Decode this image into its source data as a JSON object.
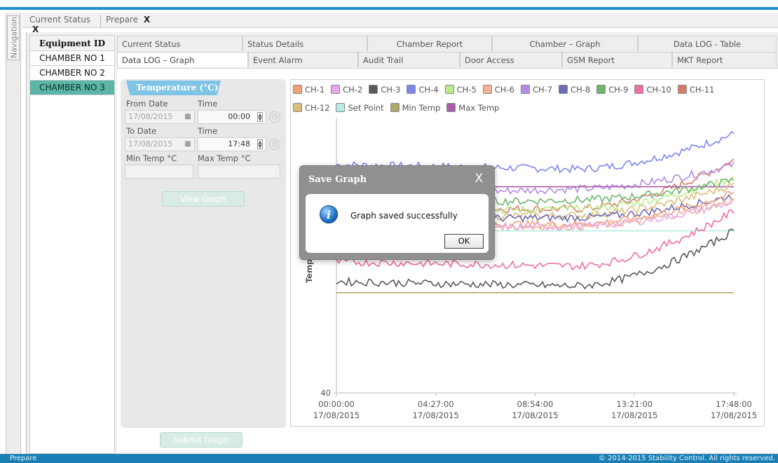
{
  "navigation": {
    "label": "Navigation"
  },
  "doc_tabs": [
    {
      "label": "Current Status",
      "close": "X"
    },
    {
      "label": "Prepare",
      "close": "X"
    }
  ],
  "equipment": {
    "header": "Equipment ID",
    "items": [
      "CHAMBER NO 1",
      "CHAMBER NO 2",
      "CHAMBER NO 3"
    ],
    "selected": "CHAMBER NO 3"
  },
  "tabs_row1": [
    "Current Status",
    "Status Details",
    "Chamber Report",
    "Chamber – Graph",
    "Data LOG - Table"
  ],
  "tabs_row2": [
    "Data LOG – Graph",
    "Event Alarm",
    "Audit Trail",
    "Door Access",
    "GSM Report",
    "MKT Report"
  ],
  "form": {
    "section_title": "Temperature (°C)",
    "from_date_label": "From Date",
    "from_date": "17/08/2015",
    "time_label_1": "Time",
    "from_time": "00:00",
    "to_date_label": "To Date",
    "to_date": "17/08/2015",
    "time_label_2": "Time",
    "to_time": "17:48",
    "min_temp_label": "Min Temp   °C",
    "max_temp_label": "Max Temp   °C",
    "view_graph": "View Graph",
    "submit_graph": "Submit Graph"
  },
  "legend": [
    {
      "name": "CH-1",
      "color": "#f0a07a"
    },
    {
      "name": "CH-2",
      "color": "#e9a8e8"
    },
    {
      "name": "CH-3",
      "color": "#5a5a5a"
    },
    {
      "name": "CH-4",
      "color": "#7f86f0"
    },
    {
      "name": "CH-5",
      "color": "#b9ec8a"
    },
    {
      "name": "CH-6",
      "color": "#f5b394"
    },
    {
      "name": "CH-7",
      "color": "#b58be6"
    },
    {
      "name": "CH-8",
      "color": "#6c6cb3"
    },
    {
      "name": "CH-9",
      "color": "#6fb56f"
    },
    {
      "name": "CH-10",
      "color": "#ef6fa8"
    },
    {
      "name": "CH-11",
      "color": "#d97b6a"
    },
    {
      "name": "CH-12",
      "color": "#d9bf7a"
    },
    {
      "name": "Set Point",
      "color": "#b7ece3"
    },
    {
      "name": "Min Temp",
      "color": "#b0a86a"
    },
    {
      "name": "Max Temp",
      "color": "#a65fa6"
    }
  ],
  "chart_data": {
    "type": "line",
    "ylabel": "Temp",
    "y_visible_tick": "40",
    "x_ticks": [
      {
        "time": "00:00:00",
        "date": "17/08/2015"
      },
      {
        "time": "04:27:00",
        "date": "17/08/2015"
      },
      {
        "time": "08:54:00",
        "date": "17/08/2015"
      },
      {
        "time": "13:21:00",
        "date": "17/08/2015"
      },
      {
        "time": "17:48:00",
        "date": "17/08/2015"
      }
    ],
    "x_hours": [
      0,
      4.45,
      8.9,
      13.35,
      17.8
    ],
    "y_range_relative": [
      0,
      1
    ],
    "series": [
      {
        "name": "CH-4",
        "color": "#7f86f0",
        "start": 0.86,
        "mid": 0.84,
        "end": 1.0
      },
      {
        "name": "CH-11",
        "color": "#d97b6a",
        "start": 0.66,
        "mid": 0.66,
        "end": 0.88
      },
      {
        "name": "CH-7",
        "color": "#b58be6",
        "start": 0.72,
        "mid": 0.75,
        "end": 0.86
      },
      {
        "name": "CH-5",
        "color": "#b9ec8a",
        "start": 0.64,
        "mid": 0.66,
        "end": 0.8
      },
      {
        "name": "Max Temp",
        "color": "#a65fa6",
        "start": 0.76,
        "mid": 0.76,
        "end": 0.76,
        "flat": true
      },
      {
        "name": "CH-9",
        "color": "#6fb56f",
        "start": 0.68,
        "mid": 0.7,
        "end": 0.79
      },
      {
        "name": "CH-12",
        "color": "#d9bf7a",
        "start": 0.62,
        "mid": 0.63,
        "end": 0.77
      },
      {
        "name": "CH-8",
        "color": "#6c6cb3",
        "start": 0.61,
        "mid": 0.62,
        "end": 0.72
      },
      {
        "name": "CH-1",
        "color": "#f0a07a",
        "start": 0.59,
        "mid": 0.59,
        "end": 0.73
      },
      {
        "name": "CH-6",
        "color": "#f5b394",
        "start": 0.58,
        "mid": 0.58,
        "end": 0.7
      },
      {
        "name": "CH-2",
        "color": "#e9a8e8",
        "start": 0.57,
        "mid": 0.58,
        "end": 0.69
      },
      {
        "name": "Set Point",
        "color": "#b7ece3",
        "start": 0.56,
        "mid": 0.56,
        "end": 0.56,
        "flat": true
      },
      {
        "name": "CH-10",
        "color": "#ef6fa8",
        "start": 0.42,
        "mid": 0.4,
        "end": 0.65
      },
      {
        "name": "CH-3",
        "color": "#5a5a5a",
        "start": 0.33,
        "mid": 0.31,
        "end": 0.56
      },
      {
        "name": "Min Temp",
        "color": "#b0a86a",
        "start": 0.28,
        "mid": 0.28,
        "end": 0.28,
        "flat": true
      }
    ]
  },
  "dialog": {
    "title": "Save Graph",
    "close": "X",
    "message": "Graph saved successfully",
    "ok": "OK"
  },
  "statusbar": {
    "left": "Prepare",
    "right": "© 2014-2015 Stability Control. All rights reserved."
  }
}
